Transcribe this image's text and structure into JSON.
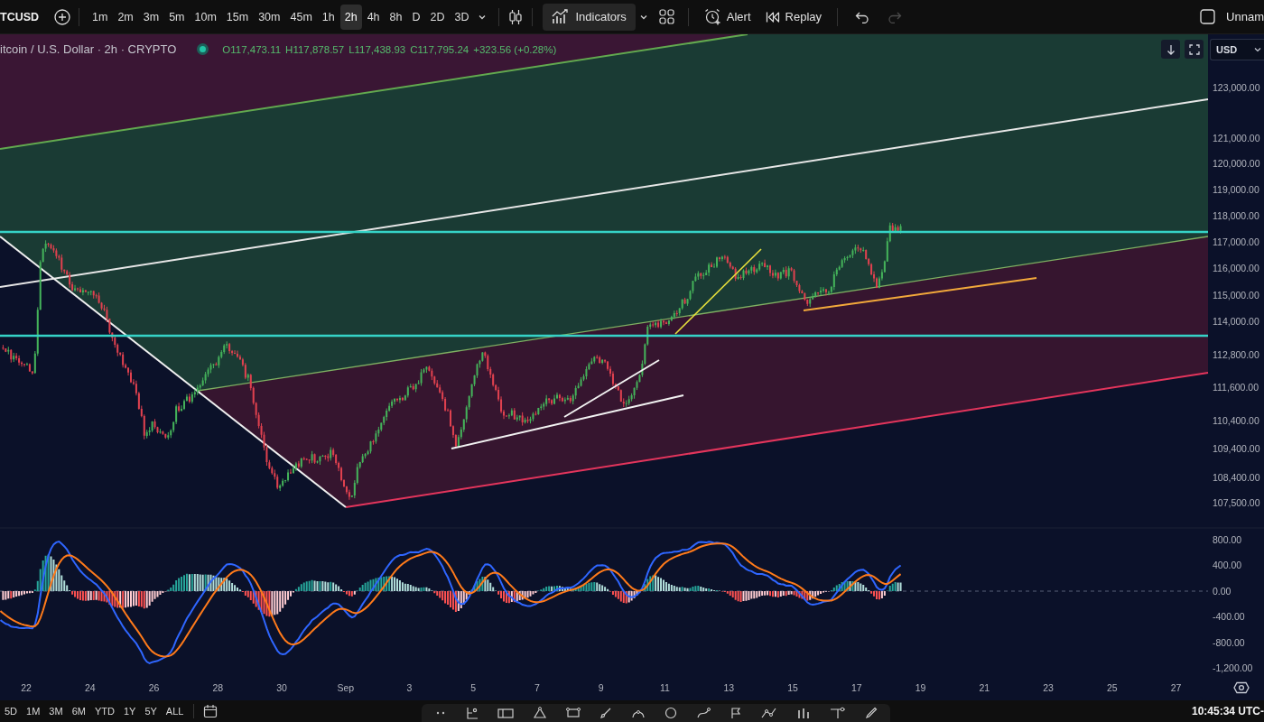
{
  "toolbar": {
    "symbol": "TCUSD",
    "intervals": [
      {
        "label": "1m",
        "selected": false
      },
      {
        "label": "2m",
        "selected": false
      },
      {
        "label": "3m",
        "selected": false
      },
      {
        "label": "5m",
        "selected": false
      },
      {
        "label": "10m",
        "selected": false
      },
      {
        "label": "15m",
        "selected": false
      },
      {
        "label": "30m",
        "selected": false
      },
      {
        "label": "45m",
        "selected": false
      },
      {
        "label": "1h",
        "selected": false
      },
      {
        "label": "2h",
        "selected": true
      },
      {
        "label": "4h",
        "selected": false
      },
      {
        "label": "8h",
        "selected": false
      },
      {
        "label": "D",
        "selected": false
      },
      {
        "label": "2D",
        "selected": false
      },
      {
        "label": "3D",
        "selected": false
      }
    ],
    "buttons": [
      {
        "kind": "indicators",
        "label": "Indicators"
      },
      {
        "kind": "alert",
        "label": "Alert"
      },
      {
        "kind": "replay",
        "label": "Replay"
      }
    ],
    "history": [
      {
        "kind": "undo",
        "disabled": false
      },
      {
        "kind": "redo",
        "disabled": true
      }
    ],
    "layout_name": "Unnam"
  },
  "legend": {
    "title": "itcoin / U.S. Dollar · 2h · CRYPTO",
    "values": [
      "O117,473.11",
      "H117,878.57",
      "L117,438.93",
      "C117,795.24",
      "+323.56 (+0.28%)"
    ]
  },
  "price_scale": {
    "currency": "USD",
    "labels": [
      "123,000.00",
      "121,000.00",
      "120,000.00",
      "119,000.00",
      "118,000.00",
      "117,000.00",
      "116,000.00",
      "115,000.00",
      "114,000.00",
      "112,800.00",
      "111,600.00",
      "110,400.00",
      "109,400.00",
      "108,400.00",
      "107,500.00"
    ]
  },
  "macd_scale": {
    "labels": [
      "800.00",
      "400.00",
      "0.00",
      "-400.00",
      "-800.00",
      "-1,200.00"
    ]
  },
  "time_axis": {
    "labels": [
      "22",
      "24",
      "26",
      "28",
      "30",
      "Sep",
      "3",
      "5",
      "7",
      "9",
      "11",
      "13",
      "15",
      "17",
      "19",
      "21",
      "23",
      "25",
      "27"
    ]
  },
  "bottom_bar": {
    "ranges": [
      "5D",
      "1M",
      "3M",
      "6M",
      "YTD",
      "1Y",
      "5Y",
      "ALL"
    ],
    "clock": "10:45:34 UTC-"
  }
}
